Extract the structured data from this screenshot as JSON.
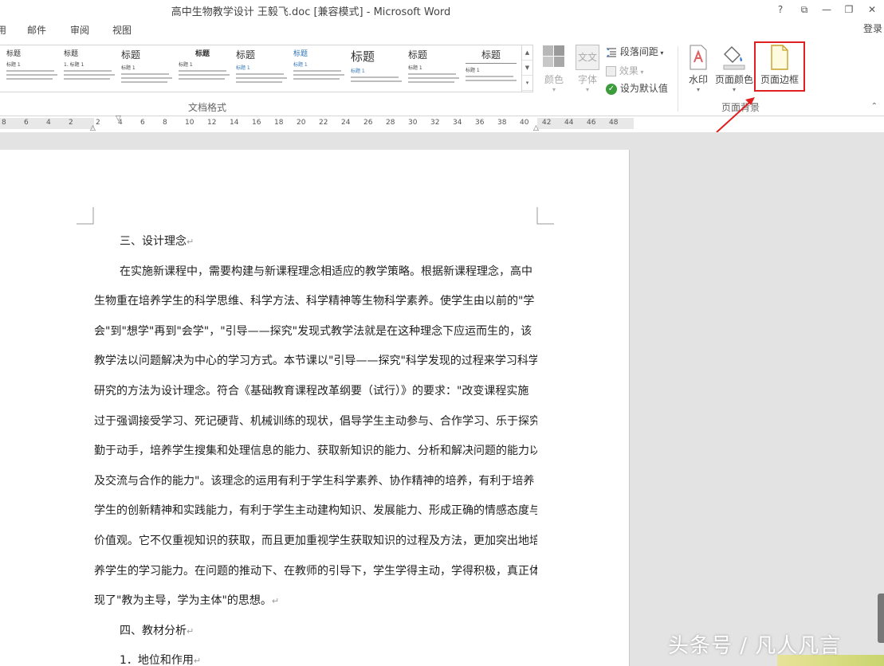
{
  "window": {
    "title": "高中生物教学设计 王毅飞.doc [兼容模式] - Microsoft Word",
    "buttons": {
      "help": "?",
      "restore_ribbon": "⧉",
      "minimize": "—",
      "maximize": "❐",
      "close": "✕"
    }
  },
  "tabs": [
    "用",
    "邮件",
    "审阅",
    "视图"
  ],
  "login": "登录",
  "ribbon": {
    "styles_gallery": [
      {
        "title": "标题",
        "sub": "标题 1"
      },
      {
        "title": "标题",
        "sub": "1. 标题 1"
      },
      {
        "title": "标题",
        "sub": "标题 1"
      },
      {
        "title": "标题",
        "sub": "标题 1"
      },
      {
        "title": "标题",
        "sub": "标题 1"
      },
      {
        "title": "标题",
        "sub": "标题 1"
      },
      {
        "title": "标题",
        "sub": "标题 1"
      },
      {
        "title": "标题",
        "sub": "标题 1"
      },
      {
        "title": "标题",
        "sub": "标题 1"
      }
    ],
    "doc_format_label": "文档格式",
    "color_label": "颜色",
    "font_label": "字体",
    "font_icon_text": "文文",
    "para_spacing": "段落间距",
    "effects": "效果",
    "set_default": "设为默认值",
    "watermark_label": "水印",
    "page_color_label": "页面颜色",
    "page_border_label": "页面边框",
    "page_background_label": "页面背景",
    "accent_color": "#e02020"
  },
  "ruler": {
    "ticks": [
      "8",
      "6",
      "4",
      "2",
      "2",
      "4",
      "6",
      "8",
      "10",
      "12",
      "14",
      "16",
      "18",
      "20",
      "22",
      "24",
      "26",
      "28",
      "30",
      "32",
      "34",
      "36",
      "38",
      "40",
      "42",
      "44",
      "46",
      "48"
    ]
  },
  "document": {
    "heading3": "三、设计理念",
    "paragraph_lines": [
      "在实施新课程中，需要构建与新课程理念相适应的教学策略。根据新课程理念，高中",
      "生物重在培养学生的科学思维、科学方法、科学精神等生物科学素养。使学生由以前的\"学",
      "会\"到\"想学\"再到\"会学\"，\"引导——探究\"发现式教学法就是在这种理念下应运而生的，该",
      "教学法以问题解决为中心的学习方式。本节课以\"引导——探究\"科学发现的过程来学习科学",
      "研究的方法为设计理念。符合《基础教育课程改革纲要（试行）》的要求：\"改变课程实施",
      "过于强调接受学习、死记硬背、机械训练的现状，倡导学生主动参与、合作学习、乐于探究、",
      "勤于动手，培养学生搜集和处理信息的能力、获取新知识的能力、分析和解决问题的能力以",
      "及交流与合作的能力\"。该理念的运用有利于学生科学素养、协作精神的培养，有利于培养",
      "学生的创新精神和实践能力，有利于学生主动建构知识、发展能力、形成正确的情感态度与",
      "价值观。它不仅重视知识的获取，而且更加重视学生获取知识的过程及方法，更加突出地培",
      "养学生的学习能力。在问题的推动下、在教师的引导下，学生学得主动，学得积极，真正体",
      "现了\"教为主导，学为主体\"的思想。"
    ],
    "heading4": "四、教材分析",
    "sub1": "1．地位和作用",
    "pilcrow": "↵"
  },
  "watermark_text": "头条号 / 凡人凡言"
}
